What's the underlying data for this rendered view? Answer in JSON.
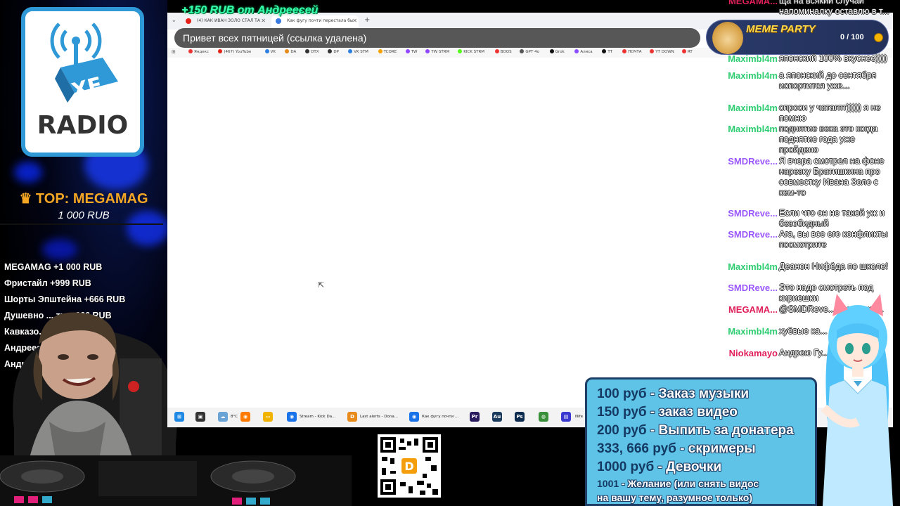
{
  "logo": {
    "text": "RADIO",
    "badge": "XE"
  },
  "top_donor": {
    "label": "♛ TOP: MEGAMAG",
    "amount": "1 000 RUB"
  },
  "recent_donors": [
    "MEGAMAG +1 000 RUB",
    "Фристайл +999 RUB",
    "Шорты Эпштейна +666 RUB",
    "Душевно ... ты +666 RUB",
    "Кавказо... RUB",
    "Андреее...",
    "Андрей ..."
  ],
  "donation_ticker": "+150 RUB  от Андрееєей",
  "browser": {
    "tabs": [
      {
        "label": "(4) КАК ИВАН ЗОЛО СТАЛ ТА",
        "color": "#e62117"
      },
      {
        "label": "Как фугу почти перестала бы",
        "color": "#3a7be0"
      }
    ],
    "new_tab": "+",
    "address_text": "Привет всех  пятницей (ссылка удалена)",
    "bookmarks": [
      {
        "label": "Яндекс",
        "color": "#e33"
      },
      {
        "label": "(467) YouTube",
        "color": "#e62117"
      },
      {
        "label": "VK",
        "color": "#2d7fe0"
      },
      {
        "label": "DA",
        "color": "#e88a1a"
      },
      {
        "label": "DTX",
        "color": "#333"
      },
      {
        "label": "DP",
        "color": "#333"
      },
      {
        "label": "VK STM",
        "color": "#2d7fe0"
      },
      {
        "label": "TCORE",
        "color": "#f3a200"
      },
      {
        "label": "TW",
        "color": "#9146ff"
      },
      {
        "label": "TW STRM",
        "color": "#9146ff"
      },
      {
        "label": "KICK STRM",
        "color": "#53fc18"
      },
      {
        "label": "BOOS",
        "color": "#e33"
      },
      {
        "label": "GPT 4o",
        "color": "#555"
      },
      {
        "label": "Grok",
        "color": "#111"
      },
      {
        "label": "Алиса",
        "color": "#8a4cff"
      },
      {
        "label": "TT",
        "color": "#111"
      },
      {
        "label": "ПОЧТА",
        "color": "#e33"
      },
      {
        "label": "YT DOWN",
        "color": "#e33"
      },
      {
        "label": "RT",
        "color": "#e33"
      }
    ],
    "taskbar": [
      {
        "label": "",
        "icon": "⊞",
        "color": "#1e88e5"
      },
      {
        "label": "",
        "icon": "▣",
        "color": "#333"
      },
      {
        "label": "8°C",
        "icon": "☁",
        "color": "#6aa3d6"
      },
      {
        "label": "",
        "icon": "◉",
        "color": "#ff7a00"
      },
      {
        "label": "",
        "icon": "▭",
        "color": "#f0b400"
      },
      {
        "label": "Stream - Kick Da...",
        "icon": "◉",
        "color": "#1a73e8"
      },
      {
        "label": "Last alerts - Dona...",
        "icon": "D",
        "color": "#e88a1a"
      },
      {
        "label": "Как фугу почти ...",
        "icon": "◉",
        "color": "#1a73e8"
      },
      {
        "label": "",
        "icon": "Pr",
        "color": "#2a1a5e"
      },
      {
        "label": "",
        "icon": "Au",
        "color": "#1a3a5e"
      },
      {
        "label": "",
        "icon": "Ps",
        "color": "#0b2a4e"
      },
      {
        "label": "",
        "icon": "◍",
        "color": "#3a8f3a"
      },
      {
        "label": "",
        "icon": "▤",
        "color": "#3a3ad0"
      },
      {
        "label": "Nife",
        "icon": "",
        "color": "#555"
      }
    ]
  },
  "meme_party": {
    "title": "MEME PARTY",
    "progress": "0 / 100"
  },
  "chat": [
    {
      "user": "MEGAMA...",
      "color": "#e0205a",
      "text": "ща на всякий случай напоминалку оставлю в т..."
    },
    {
      "user": "Maximbl4m",
      "color": "#2ecc71",
      "text": "японский 100% вкуснее))))"
    },
    {
      "user": "Maximbl4m",
      "color": "#2ecc71",
      "text": "а японский до сентября испортится уже..."
    },
    {
      "user": "Maximbl4m",
      "color": "#2ecc71",
      "text": "спроси у чатагпт))))) я не помню"
    },
    {
      "user": "Maximbl4m",
      "color": "#2ecc71",
      "text": "поднятие века это когда поднятие года уже пройдено"
    },
    {
      "user": "SMDReve...",
      "color": "#9b59ff",
      "text": "Я вчера смотрел на фоне нарезку Братишкина про совместку Ивана Золо с кем-то"
    },
    {
      "user": "SMDReve...",
      "color": "#9b59ff",
      "text": "Если что он не такой уж и безобидный"
    },
    {
      "user": "SMDReve...",
      "color": "#9b59ff",
      "text": "Ага, вы все его конфликты посмотрите"
    },
    {
      "user": "Maximbl4m",
      "color": "#2ecc71",
      "text": "Деанон Нифёда по школе!"
    },
    {
      "user": "SMDReve...",
      "color": "#9b59ff",
      "text": "Это надо смотреть под кириешки"
    },
    {
      "user": "MEGAMA...",
      "color": "#e0205a",
      "text": "@SMDReve... сказал ки..."
    },
    {
      "user": "Maximbl4m",
      "color": "#2ecc71",
      "text": "хуёвые ка... снеговики"
    },
    {
      "user": "Niokamayo",
      "color": "#e0205a",
      "text": "Андрею Гу... удалили в..."
    }
  ],
  "price_list": [
    {
      "amount": "100 руб",
      "text": " - Заказ музыки"
    },
    {
      "amount": "150 руб",
      "text": " - заказ видео"
    },
    {
      "amount": "200 руб",
      "text": " - Выпить за донатера"
    },
    {
      "amount": "333, 666 руб",
      "text": " - скримеры"
    },
    {
      "amount": "1000 руб",
      "text": " - Девочки"
    },
    {
      "amount": "1001",
      "text": " - Желание (или снять видос"
    },
    {
      "amount": "",
      "text": "на вашу тему, разумное только)"
    }
  ]
}
